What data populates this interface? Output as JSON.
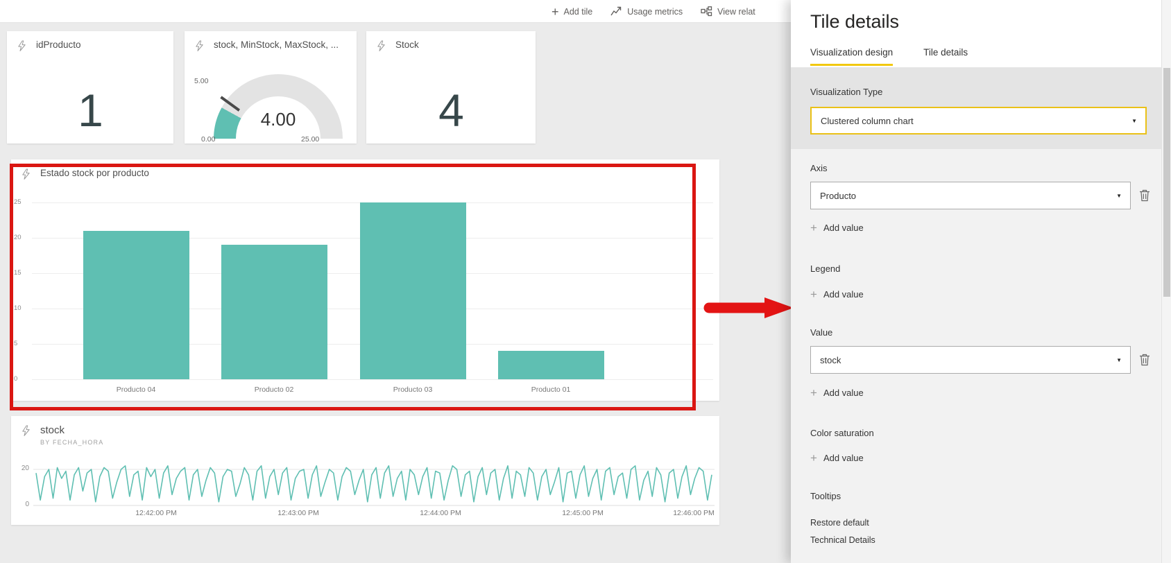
{
  "colors": {
    "teal": "#5fbfb2",
    "yellow": "#f2c80f",
    "red": "#da1612",
    "text_dark": "#333333",
    "text_gray": "#767676"
  },
  "icons": {
    "plus": "+",
    "caret": "▼"
  },
  "toolbar": {
    "add_tile": "Add tile",
    "usage_metrics": "Usage metrics",
    "view_related": "View relat"
  },
  "tiles": {
    "gauge": {
      "value_label": "4.00",
      "min_label": "0.00",
      "max_label": "25.00",
      "target_label": "5.00"
    }
  },
  "chart_data": [
    {
      "type": "card",
      "title": "idProducto",
      "value": 1
    },
    {
      "type": "gauge",
      "title": "stock, MinStock, MaxStock, ...",
      "value": 4.0,
      "min": 0.0,
      "max": 25.0,
      "target": 5.0
    },
    {
      "type": "card",
      "title": "Stock",
      "value": 4
    },
    {
      "type": "bar",
      "title": "Estado stock por producto",
      "categories": [
        "Producto 04",
        "Producto 02",
        "Producto 03",
        "Producto 01"
      ],
      "values": [
        21,
        19,
        25,
        4
      ],
      "xlabel": "",
      "ylabel": "",
      "ylim": [
        0,
        25
      ],
      "y_ticks": [
        25,
        20,
        15,
        10,
        5,
        0
      ],
      "grid": true,
      "color": "#5fbfb2",
      "legend": "none"
    },
    {
      "type": "line",
      "title": "stock",
      "subtitle": "BY FECHA_HORA",
      "x_ticks": [
        "12:42:00 PM",
        "12:43:00 PM",
        "12:44:00 PM",
        "12:45:00 PM",
        "12:46:00 PM"
      ],
      "ylim": [
        0,
        24
      ],
      "y_ticks": [
        20,
        0
      ],
      "grid": true,
      "color": "#5fbfb2",
      "values": [
        18,
        3,
        16,
        20,
        4,
        21,
        15,
        19,
        3,
        17,
        21,
        8,
        18,
        20,
        2,
        16,
        21,
        19,
        4,
        13,
        20,
        22,
        5,
        17,
        19,
        3,
        21,
        16,
        20,
        4,
        18,
        22,
        6,
        15,
        19,
        21,
        3,
        17,
        20,
        5,
        14,
        21,
        18,
        2,
        16,
        20,
        19,
        5,
        12,
        21,
        17,
        3,
        19,
        22,
        4,
        16,
        20,
        6,
        18,
        21,
        3,
        15,
        19,
        20,
        4,
        17,
        22,
        5,
        13,
        20,
        18,
        3,
        16,
        21,
        19,
        6,
        14,
        20,
        2,
        17,
        21,
        4,
        18,
        22,
        5,
        15,
        19,
        3,
        20,
        17,
        6,
        16,
        21,
        4,
        19,
        18,
        3,
        14,
        22,
        20,
        5,
        17,
        19,
        2,
        16,
        21,
        6,
        18,
        20,
        3,
        15,
        22,
        4,
        19,
        17,
        5,
        21,
        18,
        3,
        16,
        20,
        6,
        13,
        21,
        2,
        18,
        19,
        4,
        17,
        22,
        5,
        15,
        20,
        3,
        19,
        21,
        6,
        16,
        18,
        4,
        20,
        22,
        3,
        14,
        19,
        5,
        21,
        17,
        2,
        18,
        20,
        4,
        16,
        22,
        6,
        15,
        21,
        19,
        3,
        17
      ]
    }
  ],
  "panel": {
    "title": "Tile details",
    "tabs": [
      {
        "label": "Visualization design"
      },
      {
        "label": "Tile details"
      }
    ],
    "viz_type": {
      "label": "Visualization Type",
      "value": "Clustered column chart"
    },
    "axis": {
      "label": "Axis",
      "value": "Producto"
    },
    "legend": {
      "label": "Legend"
    },
    "value": {
      "label": "Value",
      "value": "stock"
    },
    "color_saturation": {
      "label": "Color saturation"
    },
    "tooltips": {
      "label": "Tooltips"
    },
    "add_value": "Add value",
    "links": {
      "restore_default": "Restore default",
      "technical_details": "Technical Details"
    }
  }
}
